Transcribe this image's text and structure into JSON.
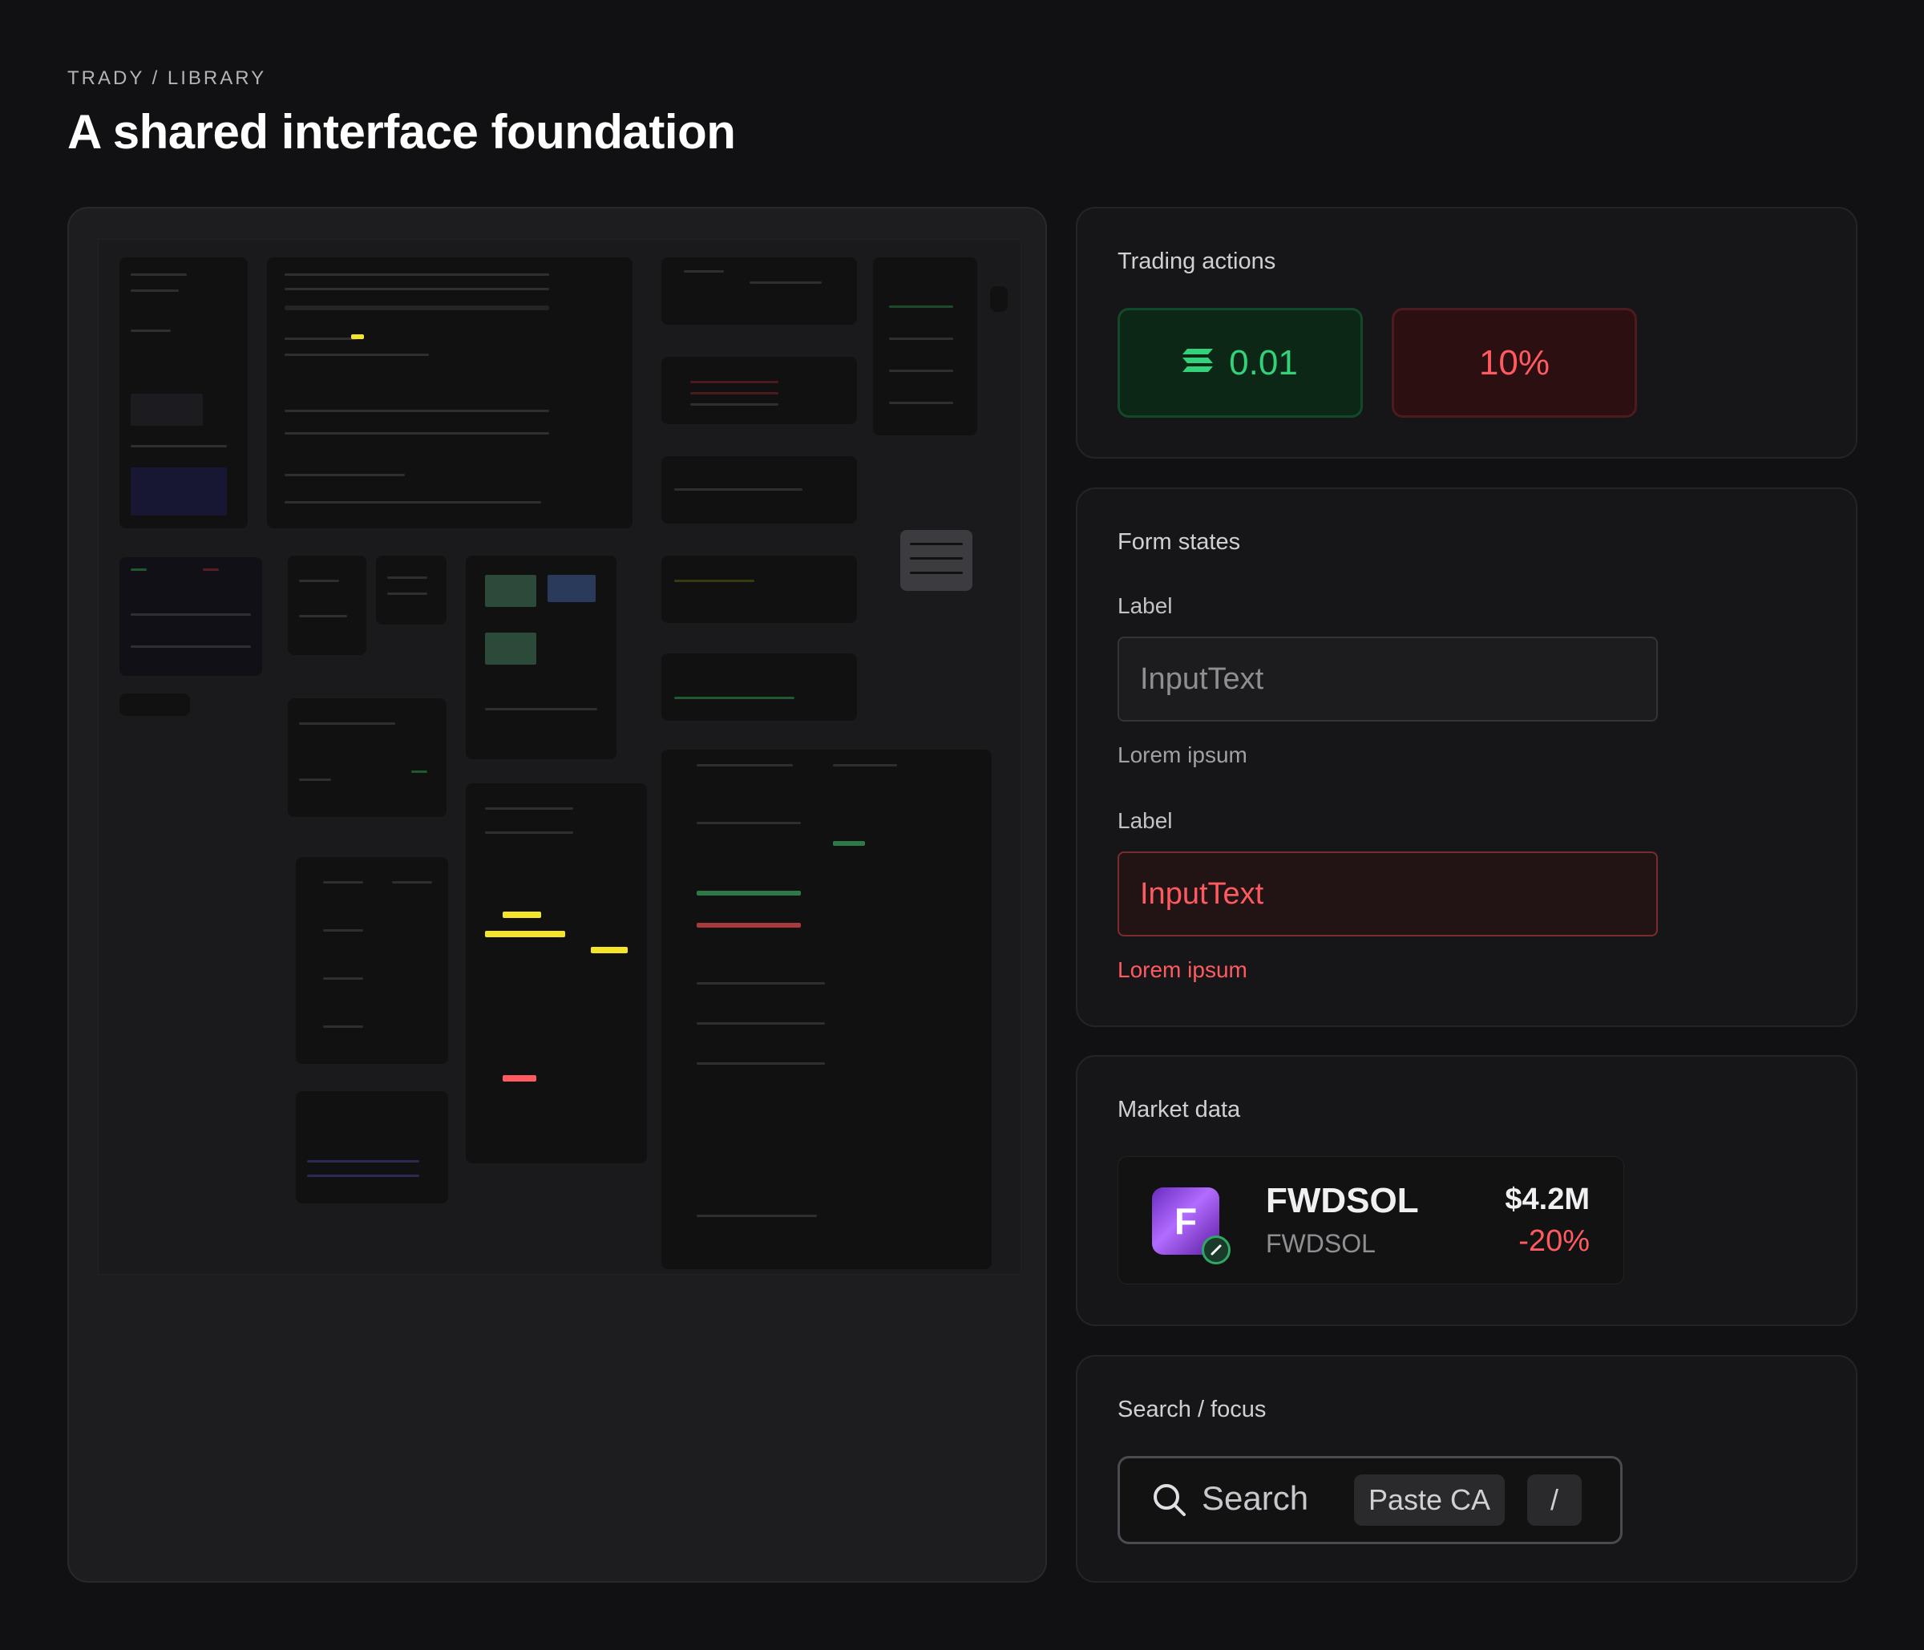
{
  "header": {
    "eyebrow": "TRADY / LIBRARY",
    "title": "A shared interface foundation"
  },
  "trading": {
    "title": "Trading actions",
    "buy_amount": "0.01",
    "sell_percent": "10%"
  },
  "form": {
    "title": "Form states",
    "normal": {
      "label": "Label",
      "value": "InputText",
      "helper": "Lorem ipsum"
    },
    "error": {
      "label": "Label",
      "value": "InputText",
      "helper": "Lorem ipsum"
    }
  },
  "market": {
    "title": "Market data",
    "token_name": "FWDSOL",
    "token_symbol": "FWDSOL",
    "market_cap": "$4.2M",
    "change": "-20%"
  },
  "search": {
    "title": "Search / focus",
    "placeholder": "Search",
    "paste_label": "Paste CA",
    "shortcut": "/"
  },
  "colors": {
    "background": "#111113",
    "buy": "#33d17a",
    "sell": "#ff5a5f",
    "accent_yellow": "#f5e52a"
  }
}
